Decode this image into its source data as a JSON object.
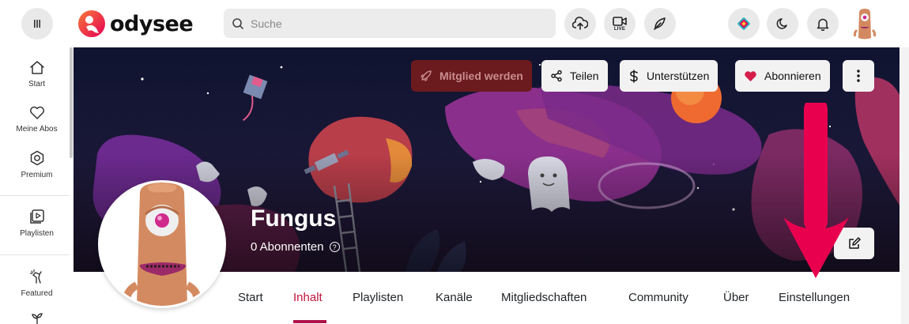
{
  "header": {
    "logo_text": "odysee",
    "search_placeholder": "Suche",
    "live_label": "LIVE",
    "icons": [
      "menu-icon",
      "upload-icon",
      "go-live-icon",
      "publish-post-icon",
      "wallet-icon",
      "dark-mode-icon",
      "notifications-icon"
    ]
  },
  "sidebar": {
    "items": [
      {
        "label": "Start",
        "icon": "home-icon"
      },
      {
        "label": "Meine Abos",
        "icon": "heart-icon"
      },
      {
        "label": "Premium",
        "icon": "premium-icon"
      },
      {
        "label": "Playlisten",
        "icon": "playlist-icon"
      },
      {
        "label": "Featured",
        "icon": "featured-icon"
      }
    ]
  },
  "channel": {
    "name": "Fungus",
    "subscribers": "0 Abonnenten",
    "help_glyph": "?"
  },
  "actions": {
    "member": "Mitglied werden",
    "share": "Teilen",
    "support": "Unterstützen",
    "follow": "Abonnieren"
  },
  "tabs": [
    {
      "label": "Start"
    },
    {
      "label": "Inhalt"
    },
    {
      "label": "Playlisten"
    },
    {
      "label": "Kanäle"
    },
    {
      "label": "Mitgliedschaften"
    },
    {
      "label": "Community"
    },
    {
      "label": "Über"
    },
    {
      "label": "Einstellungen"
    }
  ],
  "active_tab": "Inhalt",
  "colors": {
    "accent": "#c0143c",
    "member_button": "#6b1a1e",
    "arrow": "#e8004f",
    "banner_bg": "#0f1430"
  }
}
